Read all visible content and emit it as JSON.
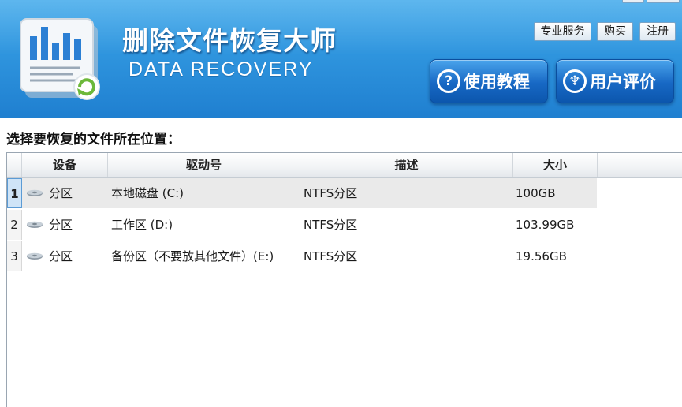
{
  "app": {
    "title_cn": "删除文件恢复大师",
    "title_en": "DATA RECOVERY"
  },
  "header": {
    "top_buttons": [
      {
        "label": "专业服务"
      },
      {
        "label": "购买"
      },
      {
        "label": "注册"
      }
    ],
    "big_buttons": [
      {
        "label": "使用教程",
        "icon": "question-icon",
        "glyph": "?"
      },
      {
        "label": "用户评价",
        "icon": "user-review-icon",
        "glyph": "♆"
      }
    ]
  },
  "main": {
    "prompt": "选择要恢复的文件所在位置：",
    "table": {
      "columns": [
        "设备",
        "驱动号",
        "描述",
        "大小"
      ],
      "rows": [
        {
          "num": "1",
          "device": "分区",
          "drive": "本地磁盘 (C:)",
          "desc": "NTFS分区",
          "size": "100GB",
          "selected": true
        },
        {
          "num": "2",
          "device": "分区",
          "drive": "工作区 (D:)",
          "desc": "NTFS分区",
          "size": "103.99GB",
          "selected": false
        },
        {
          "num": "3",
          "device": "分区",
          "drive": "备份区（不要放其他文件）(E:)",
          "desc": "NTFS分区",
          "size": "19.56GB",
          "selected": false
        }
      ]
    }
  },
  "colors": {
    "header_blue": "#2f95de",
    "button_blue": "#1768c4",
    "selected_row": "#eaeaea"
  }
}
